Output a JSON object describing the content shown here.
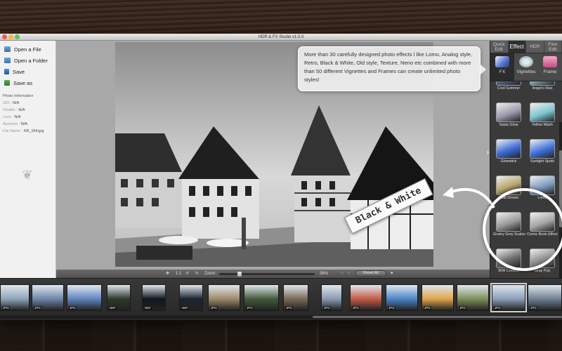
{
  "window": {
    "title": "HDR & FX Studio v1.0.0"
  },
  "sidebar": {
    "items": [
      {
        "label": "Open a File",
        "icon": "open-file-icon"
      },
      {
        "label": "Open a Folder",
        "icon": "open-folder-icon"
      },
      {
        "label": "Save",
        "icon": "save-icon"
      },
      {
        "label": "Save as",
        "icon": "save-as-icon"
      }
    ],
    "photo_info": {
      "heading": "Photo Information",
      "rows": [
        {
          "label": "ISO :",
          "value": "N/A"
        },
        {
          "label": "Shutter :",
          "value": "N/A"
        },
        {
          "label": "Lens :",
          "value": "N/A"
        },
        {
          "label": "Aperture :",
          "value": "N/A"
        },
        {
          "label": "File Name :",
          "value": "XR_164.jpg"
        }
      ]
    }
  },
  "tooltip": {
    "text": "More than 30 carefully designed photo effects l like Lomo, Analog style, Retro, Black & White, Old style, Texture, Neno etc combined with more than 50 different Vignettes and Frames can create unlimited photo styles!"
  },
  "callout": {
    "label": "Black & White"
  },
  "toolbar": {
    "ratio_label": "1:1",
    "zoom_label": "Zoom:",
    "zoom_value": "36%",
    "zoom_fraction": 0.2,
    "reset_label": "Reset All"
  },
  "right_panel": {
    "tabs": [
      {
        "label": "Quick Edit",
        "active": false
      },
      {
        "label": "Effect",
        "active": true
      },
      {
        "label": "HDR",
        "active": false
      },
      {
        "label": "Fine Edit",
        "active": false
      }
    ],
    "subtabs": [
      {
        "label": "FX",
        "active": true,
        "icon": "fx-icon"
      },
      {
        "label": "Vignettes",
        "active": false,
        "icon": "vignettes-icon"
      },
      {
        "label": "Frame",
        "active": false,
        "icon": "frame-icon"
      }
    ],
    "effects": [
      {
        "label": "Cool Summer",
        "color": "#5a6f9a"
      },
      {
        "label": "Angel's Kiss",
        "color": "#8fb3c7"
      },
      {
        "label": "Sepia Glow",
        "color": "#9b9baf"
      },
      {
        "label": "Yellow Wash",
        "color": "#7fc5d0"
      },
      {
        "label": "Glowstick",
        "color": "#3b6bd8"
      },
      {
        "label": "Sunlight Spots",
        "color": "#3f73dd"
      },
      {
        "label": "Cold Dream",
        "color": "#b7a66a"
      },
      {
        "label": "Lomo",
        "color": "#7d9cc2"
      },
      {
        "label": "Grainy Grey Scales",
        "color": "#9a9a9a"
      },
      {
        "label": "Comic Book Effect",
        "color": "#a7a7a7"
      },
      {
        "label": "B/W Comics",
        "color": "#6b6b6b"
      },
      {
        "label": "Gray Pop",
        "color": "#8c8c8c"
      }
    ]
  },
  "filmstrip": {
    "thumbs": [
      {
        "type": "JPG",
        "color": "#8fa4b8"
      },
      {
        "type": "JPG",
        "color": "#6e86a8"
      },
      {
        "type": "JPG",
        "color": "#5f86bf"
      },
      {
        "type": "NEF",
        "color": "#2d3b2a"
      },
      {
        "type": "NEF",
        "color": "#12161d"
      },
      {
        "type": "NEF",
        "color": "#1b2430"
      },
      {
        "type": "JPG",
        "color": "#9e8a6a"
      },
      {
        "type": "JPG",
        "color": "#445a3c"
      },
      {
        "type": "JPG",
        "color": "#7a6a58"
      },
      {
        "type": "JPG",
        "color": "#8a9ab2"
      },
      {
        "type": "JPG",
        "color": "#c45a45"
      },
      {
        "type": "JPG",
        "color": "#4a86c7"
      },
      {
        "type": "JPG",
        "color": "#e0a54a"
      },
      {
        "type": "JPG",
        "color": "#7d8f5a"
      },
      {
        "type": "JPG",
        "color": "#8d9eb9"
      },
      {
        "type": "JPG",
        "color": "#6f7f92"
      }
    ]
  }
}
